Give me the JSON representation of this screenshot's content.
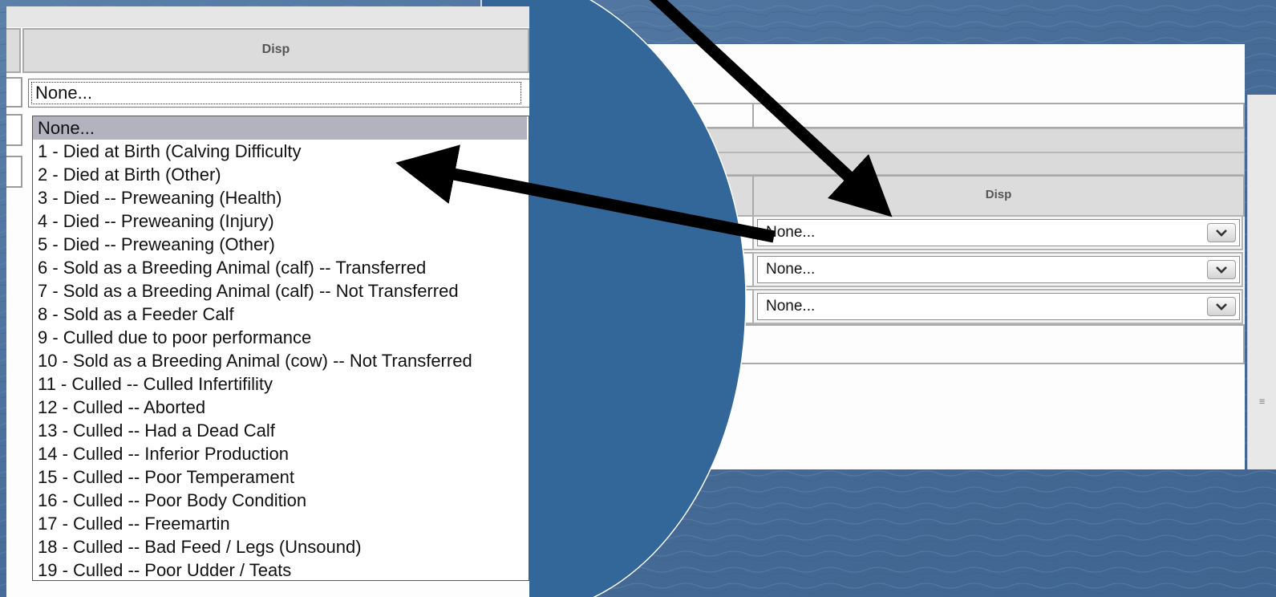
{
  "left_view": {
    "column_header": "Disp",
    "select_value": "None...",
    "options": [
      "None...",
      "1 - Died at Birth (Calving Difficulty",
      "2 - Died at Birth (Other)",
      "3 - Died -- Preweaning (Health)",
      "4 - Died -- Preweaning (Injury)",
      "5 - Died -- Preweaning (Other)",
      "6 - Sold as a Breeding Animal (calf) -- Transferred",
      "7 - Sold as a Breeding Animal (calf) -- Not Transferred",
      "8 - Sold as a Feeder Calf",
      "9 - Culled due to poor performance",
      "10 - Sold as a Breeding Animal (cow) -- Not Transferred",
      "11 - Culled -- Culled Infertifility",
      "12 - Culled -- Aborted",
      "13 - Culled -- Had a Dead Calf",
      "14 - Culled -- Inferior Production",
      "15 - Culled -- Poor Temperament",
      "16 - Culled -- Poor Body Condition",
      "17 - Culled -- Freemartin",
      "18 - Culled -- Bad Feed / Legs (Unsound)",
      "19 - Culled -- Poor Udder / Teats"
    ],
    "selected_index": 0
  },
  "right_view": {
    "column_header": "Disp",
    "rows": [
      {
        "value": "None..."
      },
      {
        "value": "None..."
      },
      {
        "value": "None..."
      }
    ]
  },
  "colors": {
    "background": "#4a6f99",
    "circle": "#336699",
    "arrow": "#000000"
  },
  "icons": [
    "chevron-down-icon",
    "scroll-grip-icon"
  ]
}
